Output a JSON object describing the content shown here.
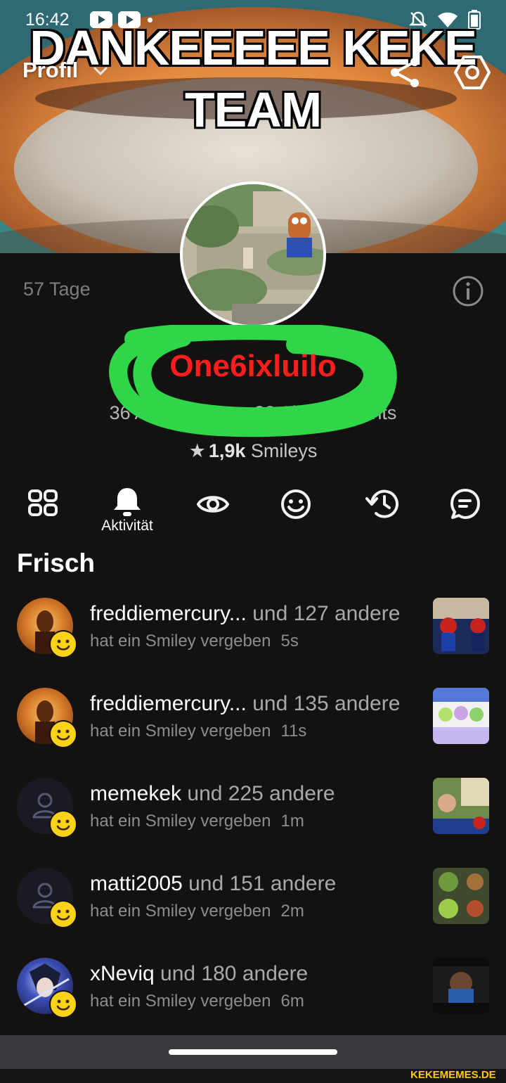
{
  "status_bar": {
    "time": "16:42"
  },
  "meme_caption": {
    "line1": "DANKEEEEE KEKE",
    "line2": "TEAM"
  },
  "header": {
    "title": "Profil"
  },
  "profile": {
    "days": "57 Tage",
    "username": "One6ixluilo",
    "stats": "36 Abonnenten • 38 Abonnements",
    "smileys_count": "1,9k",
    "smileys_label": "Smileys"
  },
  "tabs": [
    {
      "id": "overview",
      "icon": "grid-icon"
    },
    {
      "id": "activity",
      "icon": "bell-icon",
      "label": "Aktivität",
      "active": true
    },
    {
      "id": "views",
      "icon": "eye-icon"
    },
    {
      "id": "smileys",
      "icon": "smiley-icon"
    },
    {
      "id": "history",
      "icon": "history-icon"
    },
    {
      "id": "comments",
      "icon": "comment-icon"
    }
  ],
  "feed": {
    "title": "Frisch",
    "items": [
      {
        "user": "freddiemercury...",
        "others": "und 127 andere",
        "action": "hat ein Smiley vergeben",
        "time": "5s"
      },
      {
        "user": "freddiemercury...",
        "others": "und 135 andere",
        "action": "hat ein Smiley vergeben",
        "time": "11s"
      },
      {
        "user": "memekek",
        "others": "und 225 andere",
        "action": "hat ein Smiley vergeben",
        "time": "1m"
      },
      {
        "user": "matti2005",
        "others": "und 151 andere",
        "action": "hat ein Smiley vergeben",
        "time": "2m"
      },
      {
        "user": "xNeviq",
        "others": "und 180 andere",
        "action": "hat ein Smiley vergeben",
        "time": "6m"
      }
    ]
  },
  "watermark": "KEKEMEMES.DE",
  "colors": {
    "username": "#ff1d1d",
    "scribble": "#2fd64a",
    "smiley": "#ffd21a",
    "background": "#131210"
  }
}
